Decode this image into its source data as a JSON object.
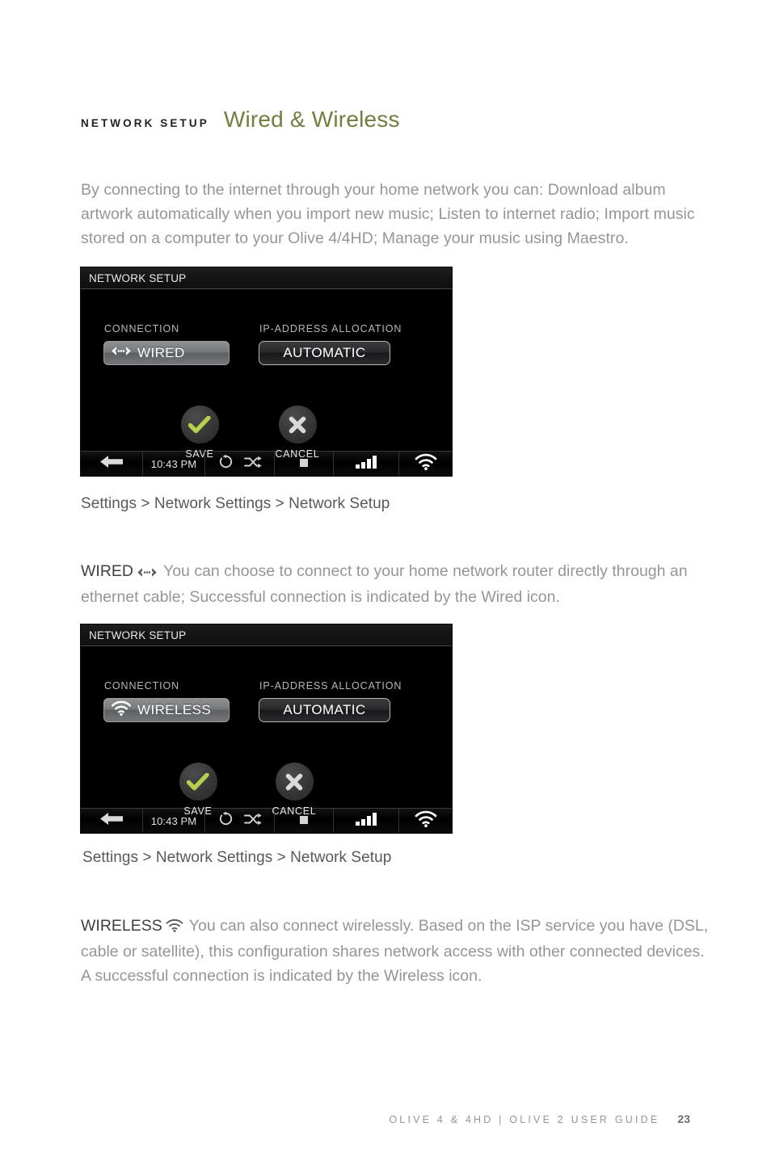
{
  "header": {
    "eyebrow": "NETWORK SETUP",
    "title": "Wired & Wireless"
  },
  "intro": "By connecting to the internet through your home network you can: Download album artwork automatically when you import new music; Listen to internet radio; Import music stored on a computer to your Olive 4/4HD; Manage your music using Maestro.",
  "accent_color": "#6f7f3d",
  "screens": [
    {
      "title": "NETWORK SETUP",
      "connection_label": "CONNECTION",
      "connection_value": "WIRED",
      "connection_icon": "wired-icon",
      "ip_label": "IP-ADDRESS ALLOCATION",
      "ip_value": "AUTOMATIC",
      "save_label": "SAVE",
      "cancel_label": "CANCEL",
      "status": {
        "time": "10:43 PM",
        "back_icon": "back-arrow-icon",
        "repeat_icon": "repeat-icon",
        "shuffle_icon": "shuffle-icon",
        "stop_icon": "stop-icon",
        "signal_icon": "signal-bars-icon",
        "wifi_icon": "wifi-icon"
      }
    },
    {
      "title": "NETWORK SETUP",
      "connection_label": "CONNECTION",
      "connection_value": "WIRELESS",
      "connection_icon": "wifi-icon",
      "ip_label": "IP-ADDRESS ALLOCATION",
      "ip_value": "AUTOMATIC",
      "save_label": "SAVE",
      "cancel_label": "CANCEL",
      "status": {
        "time": "10:43 PM",
        "back_icon": "back-arrow-icon",
        "repeat_icon": "repeat-icon",
        "shuffle_icon": "shuffle-icon",
        "stop_icon": "stop-icon",
        "signal_icon": "signal-bars-icon",
        "wifi_icon": "wifi-icon"
      }
    }
  ],
  "captions": {
    "first": "Settings > Network Settings > Network Setup",
    "second": "Settings > Network Settings > Network Setup"
  },
  "descriptions": {
    "wired_term": "WIRED",
    "wired_text": "You can choose to connect to your home network router directly through an ethernet cable; Successful connection is indicated by the Wired icon.",
    "wireless_term": "WIRELESS",
    "wireless_text": "You can also connect wirelessly. Based on the ISP service you have (DSL, cable or satellite), this configuration shares network access with other connected devices. A successful connection is indicated by the Wireless icon."
  },
  "footer": {
    "text": "OLIVE 4 & 4HD  |  OLIVE 2 USER GUIDE",
    "page": "23"
  }
}
